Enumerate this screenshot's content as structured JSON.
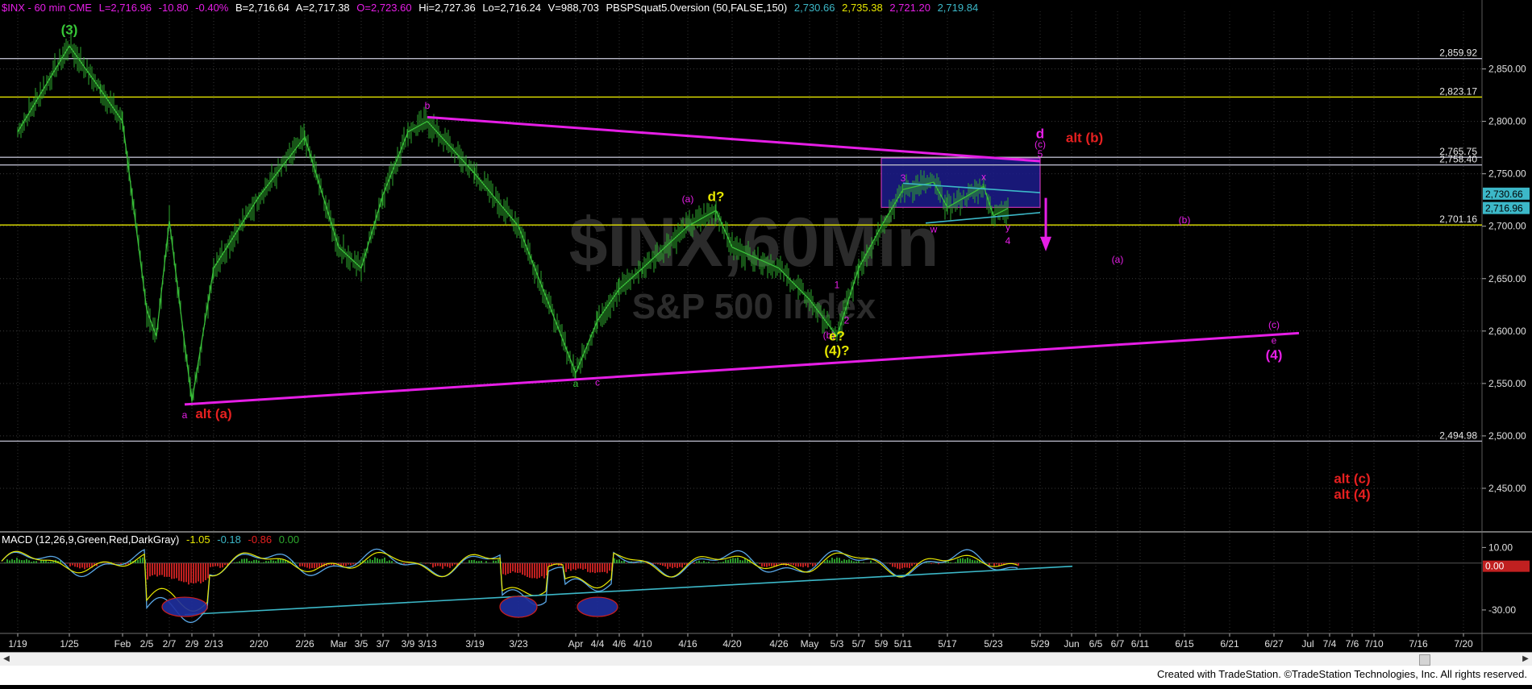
{
  "header": {
    "symbol": "$INX - 60 min  CME",
    "last": "L=2,716.96",
    "change": "-10.80",
    "change_pct": "-0.40%",
    "bid": "B=2,716.64",
    "ask": "A=2,717.38",
    "open": "O=2,723.60",
    "high": "Hi=2,727.36",
    "low": "Lo=2,716.24",
    "volume": "V=988,703",
    "study": "PBSPSquat5.0version (50,FALSE,150)",
    "v1": "2,730.66",
    "v2": "2,735.38",
    "v3": "2,721.20",
    "v4": "2,719.84"
  },
  "macd_header": {
    "name": "MACD (12,26,9,Green,Red,DarkGray)",
    "v1": "-1.05",
    "v2": "-0.18",
    "v3": "-0.86",
    "v4": "0.00"
  },
  "watermark": {
    "symbol": "$INX,60Min",
    "name": "S&P 500 Index"
  },
  "footer": "Created with TradeStation. ©TradeStation Technologies, Inc. All rights reserved.",
  "colors": {
    "background": "#000000",
    "price": "#2ea82e",
    "magenta": "#e61ee6",
    "yellow": "#e6e600",
    "red": "#e62020",
    "green_label": "#38c838",
    "hline": "#b8b8c8",
    "cyan": "#3cb8c8",
    "box": "#1c1c8c"
  },
  "chart_data": {
    "type": "line",
    "title": "$INX - 60 min",
    "price_axis": {
      "ylim": [
        2410,
        2905
      ],
      "ticks": [
        "2,850.00",
        "2,800.00",
        "2,750.00",
        "2,700.00",
        "2,650.00",
        "2,600.00",
        "2,550.00",
        "2,500.00",
        "2,450.00"
      ]
    },
    "date_axis": [
      "1/19",
      "1/25",
      "Feb",
      "2/5",
      "2/7",
      "2/9",
      "2/13",
      "2/20",
      "2/26",
      "Mar",
      "3/5",
      "3/7",
      "3/9",
      "3/13",
      "3/19",
      "3/23",
      "Apr",
      "4/4",
      "4/6",
      "4/10",
      "4/16",
      "4/20",
      "4/26",
      "May",
      "5/3",
      "5/7",
      "5/9",
      "5/11",
      "5/17",
      "5/23",
      "5/29",
      "Jun",
      "6/5",
      "6/7",
      "6/11",
      "6/15",
      "6/21",
      "6/27",
      "Jul",
      "7/4",
      "7/6",
      "7/10",
      "7/16",
      "7/20"
    ],
    "series": [
      {
        "values": [
          {
            "x": "1/19",
            "y": 2790
          },
          {
            "x": "1/25",
            "y": 2872
          },
          {
            "x": "1/29",
            "y": 2830
          },
          {
            "x": "Feb",
            "y": 2800
          },
          {
            "x": "2/5",
            "y": 2620
          },
          {
            "x": "2/6",
            "y": 2595
          },
          {
            "x": "2/7",
            "y": 2705
          },
          {
            "x": "2/9",
            "y": 2533
          },
          {
            "x": "2/13",
            "y": 2660
          },
          {
            "x": "2/20",
            "y": 2728
          },
          {
            "x": "2/26",
            "y": 2785
          },
          {
            "x": "Mar",
            "y": 2680
          },
          {
            "x": "3/5",
            "y": 2660
          },
          {
            "x": "3/7",
            "y": 2730
          },
          {
            "x": "3/9",
            "y": 2790
          },
          {
            "x": "3/13",
            "y": 2800
          },
          {
            "x": "3/19",
            "y": 2750
          },
          {
            "x": "3/23",
            "y": 2700
          },
          {
            "x": "Apr",
            "y": 2560
          },
          {
            "x": "4/4",
            "y": 2610
          },
          {
            "x": "4/6",
            "y": 2640
          },
          {
            "x": "4/10",
            "y": 2660
          },
          {
            "x": "4/16",
            "y": 2700
          },
          {
            "x": "4/18",
            "y": 2715
          },
          {
            "x": "4/20",
            "y": 2680
          },
          {
            "x": "4/26",
            "y": 2660
          },
          {
            "x": "May",
            "y": 2630
          },
          {
            "x": "5/3",
            "y": 2595
          },
          {
            "x": "5/7",
            "y": 2660
          },
          {
            "x": "5/9",
            "y": 2700
          },
          {
            "x": "5/11",
            "y": 2735
          },
          {
            "x": "5/14",
            "y": 2742
          },
          {
            "x": "5/17",
            "y": 2718
          },
          {
            "x": "5/21",
            "y": 2738
          },
          {
            "x": "5/23",
            "y": 2710
          },
          {
            "x": "5/25",
            "y": 2717
          }
        ]
      }
    ],
    "horizontal_levels": [
      {
        "value": 2859.92,
        "label": "2,859.92",
        "color": "#b8b8c8"
      },
      {
        "value": 2823.17,
        "label": "2,823.17",
        "color": "#e6e600"
      },
      {
        "value": 2765.75,
        "label": "2,765.75",
        "color": "#b8b8c8"
      },
      {
        "value": 2758.4,
        "label": "2,758.40",
        "color": "#b8b8c8"
      },
      {
        "value": 2701.16,
        "label": "2,701.16",
        "color": "#e6e600"
      },
      {
        "value": 2494.98,
        "label": "2,494.98",
        "color": "#b8b8c8"
      }
    ],
    "last_value_tags": [
      {
        "value": 2730.66,
        "label": "2,730.66"
      },
      {
        "value": 2716.96,
        "label": "2,716.96"
      }
    ],
    "trendlines": [
      {
        "name": "upper",
        "from": {
          "x": "3/13",
          "y": 2804
        },
        "to": {
          "x": "5/29",
          "y": 2762
        },
        "color": "#e61ee6"
      },
      {
        "name": "lower",
        "from": {
          "x": "2/8",
          "y": 2530
        },
        "to": {
          "x": "6/29",
          "y": 2598
        },
        "color": "#e61ee6"
      },
      {
        "name": "triangle-top",
        "from": {
          "x": "5/11",
          "y": 2741
        },
        "to": {
          "x": "5/29",
          "y": 2732
        },
        "color": "#3cb8c8"
      },
      {
        "name": "triangle-bottom",
        "from": {
          "x": "5/13",
          "y": 2703
        },
        "to": {
          "x": "5/29",
          "y": 2713
        },
        "color": "#3cb8c8"
      }
    ],
    "target_box": {
      "y_from": 2718,
      "y_to": 2765,
      "x_from": "5/9",
      "x_to": "5/29"
    },
    "annotations": [
      {
        "text": "(3)",
        "x": "1/25",
        "y": 2883,
        "color": "#38c838"
      },
      {
        "text": "b",
        "x": "3/13",
        "y": 2812,
        "color": "#e61ee6"
      },
      {
        "text": "a",
        "x": "2/8",
        "y": 2517,
        "color": "#e61ee6"
      },
      {
        "text": "alt (a)",
        "x": "2/13",
        "y": 2517,
        "color": "#e62020"
      },
      {
        "text": "a",
        "x": "Apr",
        "y": 2547,
        "color": "#38c838"
      },
      {
        "text": "c",
        "x": "4/4",
        "y": 2548,
        "color": "#e61ee6"
      },
      {
        "text": "(a)",
        "x": "4/16",
        "y": 2723,
        "color": "#e61ee6"
      },
      {
        "text": "d?",
        "x": "4/18",
        "y": 2724,
        "color": "#e6e600"
      },
      {
        "text": "1",
        "x": "5/3",
        "y": 2641,
        "color": "#e61ee6"
      },
      {
        "text": "2",
        "x": "5/4",
        "y": 2607,
        "color": "#e61ee6"
      },
      {
        "text": "(b)",
        "x": "5/2",
        "y": 2593,
        "color": "#e61ee6"
      },
      {
        "text": "e?",
        "x": "5/3",
        "y": 2591,
        "color": "#e6e600"
      },
      {
        "text": "(4)?",
        "x": "5/3",
        "y": 2577,
        "color": "#e6e600"
      },
      {
        "text": "3",
        "x": "5/11",
        "y": 2743,
        "color": "#e61ee6"
      },
      {
        "text": "w",
        "x": "5/14",
        "y": 2694,
        "color": "#e61ee6"
      },
      {
        "text": "x",
        "x": "5/21",
        "y": 2744,
        "color": "#e61ee6"
      },
      {
        "text": "y",
        "x": "5/25",
        "y": 2696,
        "color": "#e61ee6"
      },
      {
        "text": "4",
        "x": "5/25",
        "y": 2683,
        "color": "#e61ee6"
      },
      {
        "text": "d",
        "x": "5/29",
        "y": 2784,
        "color": "#e61ee6"
      },
      {
        "text": "(c)",
        "x": "5/29",
        "y": 2775,
        "color": "#e61ee6"
      },
      {
        "text": "5",
        "x": "5/29",
        "y": 2766,
        "color": "#e61ee6"
      },
      {
        "text": "alt (b)",
        "x": "6/1",
        "y": 2780,
        "color": "#e62020"
      },
      {
        "text": "(b)",
        "x": "6/15",
        "y": 2703,
        "color": "#e61ee6"
      },
      {
        "text": "(a)",
        "x": "6/7",
        "y": 2665,
        "color": "#e61ee6"
      },
      {
        "text": "(c)",
        "x": "6/27",
        "y": 2603,
        "color": "#e61ee6"
      },
      {
        "text": "e",
        "x": "6/27",
        "y": 2588,
        "color": "#e61ee6"
      },
      {
        "text": "(4)",
        "x": "6/27",
        "y": 2573,
        "color": "#e61ee6"
      },
      {
        "text": "alt (c)",
        "x": "7/6",
        "y": 2455,
        "color": "#e62020"
      },
      {
        "text": "alt (4)",
        "x": "7/6",
        "y": 2440,
        "color": "#e62020"
      }
    ],
    "macd": {
      "ylim": [
        -45,
        20
      ],
      "ticks": [
        "10.00",
        "-30.00"
      ],
      "last_value": "0.00",
      "ellipses": [
        "2/8",
        "3/23",
        "4/4"
      ]
    }
  }
}
